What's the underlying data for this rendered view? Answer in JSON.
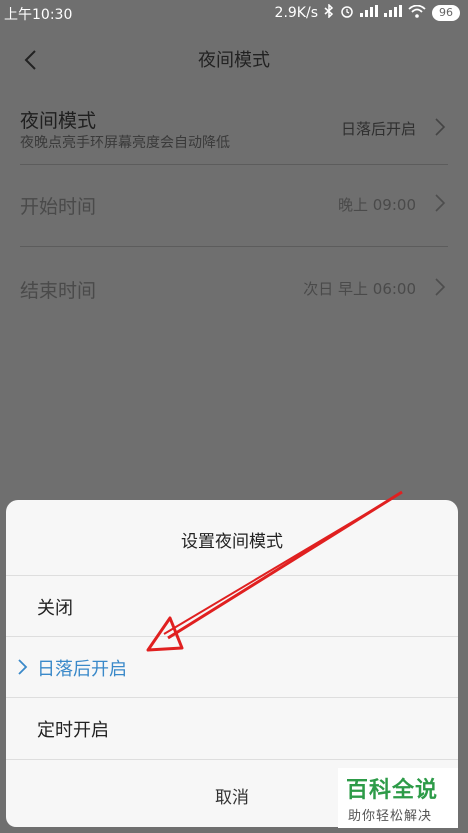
{
  "status_bar": {
    "time": "上午10:30",
    "network_speed": "2.9K/s",
    "battery": "96"
  },
  "header": {
    "title": "夜间模式"
  },
  "settings": {
    "night_mode": {
      "title": "夜间模式",
      "subtitle": "夜晚点亮手环屏幕亮度会自动降低",
      "value": "日落后开启"
    },
    "start_time": {
      "title": "开始时间",
      "value": "晚上 09:00"
    },
    "end_time": {
      "title": "结束时间",
      "value": "次日 早上 06:00"
    }
  },
  "sheet": {
    "title": "设置夜间模式",
    "options": [
      {
        "label": "关闭",
        "selected": false
      },
      {
        "label": "日落后开启",
        "selected": true
      },
      {
        "label": "定时开启",
        "selected": false
      }
    ],
    "cancel_label": "取消"
  },
  "watermark": {
    "main": "百科全说",
    "sub": "助你轻松解决"
  },
  "colors": {
    "overlay": "#6f6f6f",
    "selected_accent": "#3a89c9",
    "annotation_arrow": "#e02020",
    "watermark_green": "#2d9b48"
  }
}
